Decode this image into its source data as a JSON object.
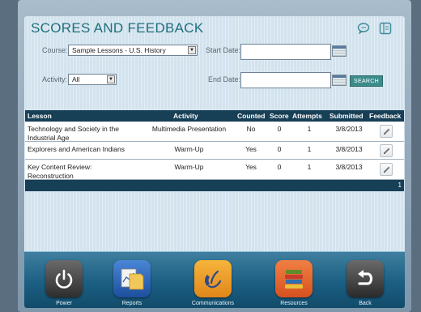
{
  "header": {
    "title": "SCORES AND FEEDBACK",
    "icons": [
      "chat-bubble-icon",
      "sidebar-window-icon"
    ]
  },
  "filters": {
    "course_label": "Course:",
    "course_value": "Sample Lessons - U.S. History",
    "activity_label": "Activity:",
    "activity_value": "All",
    "start_date_label": "Start Date:",
    "start_date_value": "",
    "end_date_label": "End Date:",
    "end_date_value": "",
    "search_label": "SEARCH"
  },
  "table": {
    "columns": [
      "Lesson",
      "Activity",
      "Counted",
      "Score",
      "Attempts",
      "Submitted",
      "Feedback"
    ],
    "rows": [
      {
        "lesson": "Technology and Society in the Industrial Age",
        "activity": "Multimedia Presentation",
        "counted": "No",
        "score": "0",
        "attempts": "1",
        "submitted": "3/8/2013"
      },
      {
        "lesson": "Explorers and American Indians",
        "activity": "Warm-Up",
        "counted": "Yes",
        "score": "0",
        "attempts": "1",
        "submitted": "3/8/2013"
      },
      {
        "lesson": "Key Content Review: Reconstruction",
        "activity": "Warm-Up",
        "counted": "Yes",
        "score": "0",
        "attempts": "1",
        "submitted": "3/8/2013"
      }
    ],
    "page_number": "1"
  },
  "dock": {
    "items": [
      {
        "label": "Power",
        "icon": "power-icon"
      },
      {
        "label": "Reports",
        "icon": "reports-icon"
      },
      {
        "label": "Communications",
        "icon": "phone-icon"
      },
      {
        "label": "Resources",
        "icon": "books-icon"
      },
      {
        "label": "Back",
        "icon": "back-arrow-icon"
      }
    ]
  }
}
